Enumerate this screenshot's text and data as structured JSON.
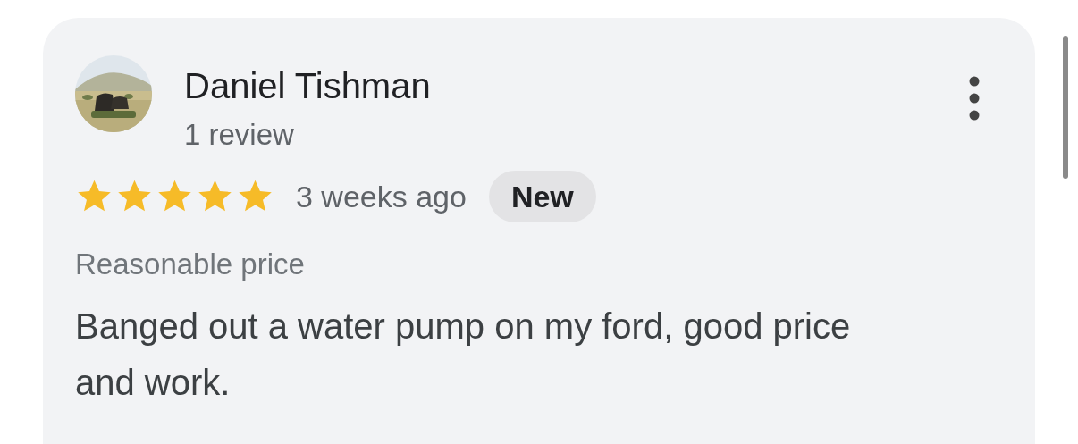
{
  "review": {
    "author": "Daniel Tishman",
    "review_count": "1 review",
    "stars": 5,
    "time": "3 weeks ago",
    "badge": "New",
    "attribute": "Reasonable price",
    "text": "Banged out a water pump on my ford, good price and work."
  }
}
